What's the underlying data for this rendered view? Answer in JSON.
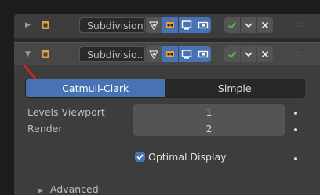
{
  "header1": {
    "name": "Subdivision"
  },
  "header2": {
    "name": "Subdivisio..."
  },
  "subdivision_type": {
    "options": [
      "Catmull-Clark",
      "Simple"
    ],
    "selected": "Catmull-Clark"
  },
  "levels_viewport": {
    "label": "Levels Viewport",
    "value": "1"
  },
  "render": {
    "label": "Render",
    "value": "2"
  },
  "optimal_display": {
    "label": "Optimal Display",
    "checked": true
  },
  "advanced": {
    "label": "Advanced"
  },
  "icons": {
    "modifier": "modifier-wrench-icon",
    "edit_mode": "edit-mode-vertex-icon",
    "on_cage": "on-cage-icon",
    "viewport": "viewport-display-icon",
    "render": "camera-render-icon",
    "apply": "checkmark-icon",
    "menu": "chevron-down-icon",
    "remove": "close-icon",
    "drag": "drag-handle-icon"
  },
  "colors": {
    "accent": "#4772b3",
    "apply_green": "#4cbe4c",
    "panel": "#3d3d3d"
  }
}
